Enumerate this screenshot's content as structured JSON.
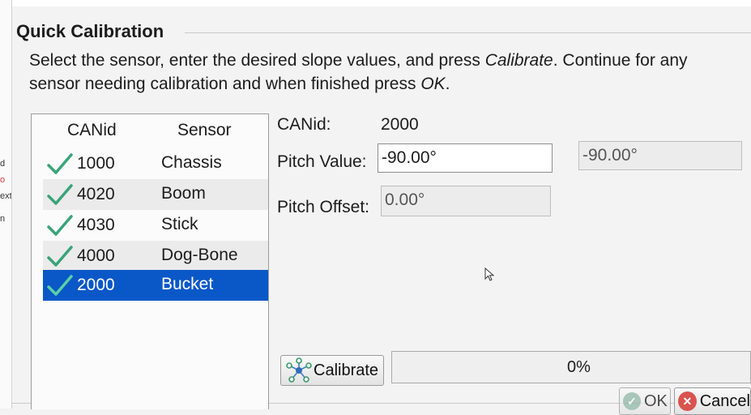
{
  "group": {
    "title": "Quick Calibration"
  },
  "instructions": {
    "part1": "Select the sensor, enter the desired slope values, and press ",
    "calibrate_word": "Calibrate",
    "part2": ". Continue for any sensor needing calibration and when finished press ",
    "ok_word": "OK",
    "part3": "."
  },
  "sensor_list": {
    "columns": [
      "CANid",
      "Sensor"
    ],
    "rows": [
      {
        "canid": "1000",
        "sensor": "Chassis",
        "checked": true
      },
      {
        "canid": "4020",
        "sensor": "Boom",
        "checked": true
      },
      {
        "canid": "4030",
        "sensor": "Stick",
        "checked": true
      },
      {
        "canid": "4000",
        "sensor": "Dog-Bone",
        "checked": true
      },
      {
        "canid": "2000",
        "sensor": "Bucket",
        "checked": true,
        "selected": true
      }
    ]
  },
  "details": {
    "canid_label": "CANid:",
    "canid_value": "2000",
    "pitch_value_label": "Pitch Value:",
    "pitch_value": "-90.00°",
    "pitch_value_readout": "-90.00°",
    "pitch_offset_label": "Pitch Offset:",
    "pitch_offset": "0.00°"
  },
  "actions": {
    "calibrate_label": "Calibrate",
    "progress_text": "0%",
    "ok_label": "OK",
    "cancel_label": "Cancel"
  },
  "left_edge_fragments": [
    "d",
    "o",
    "ext",
    "n"
  ],
  "colors": {
    "selection": "#0a58c7",
    "check": "#3aa37a",
    "cancel": "#d9534f"
  }
}
